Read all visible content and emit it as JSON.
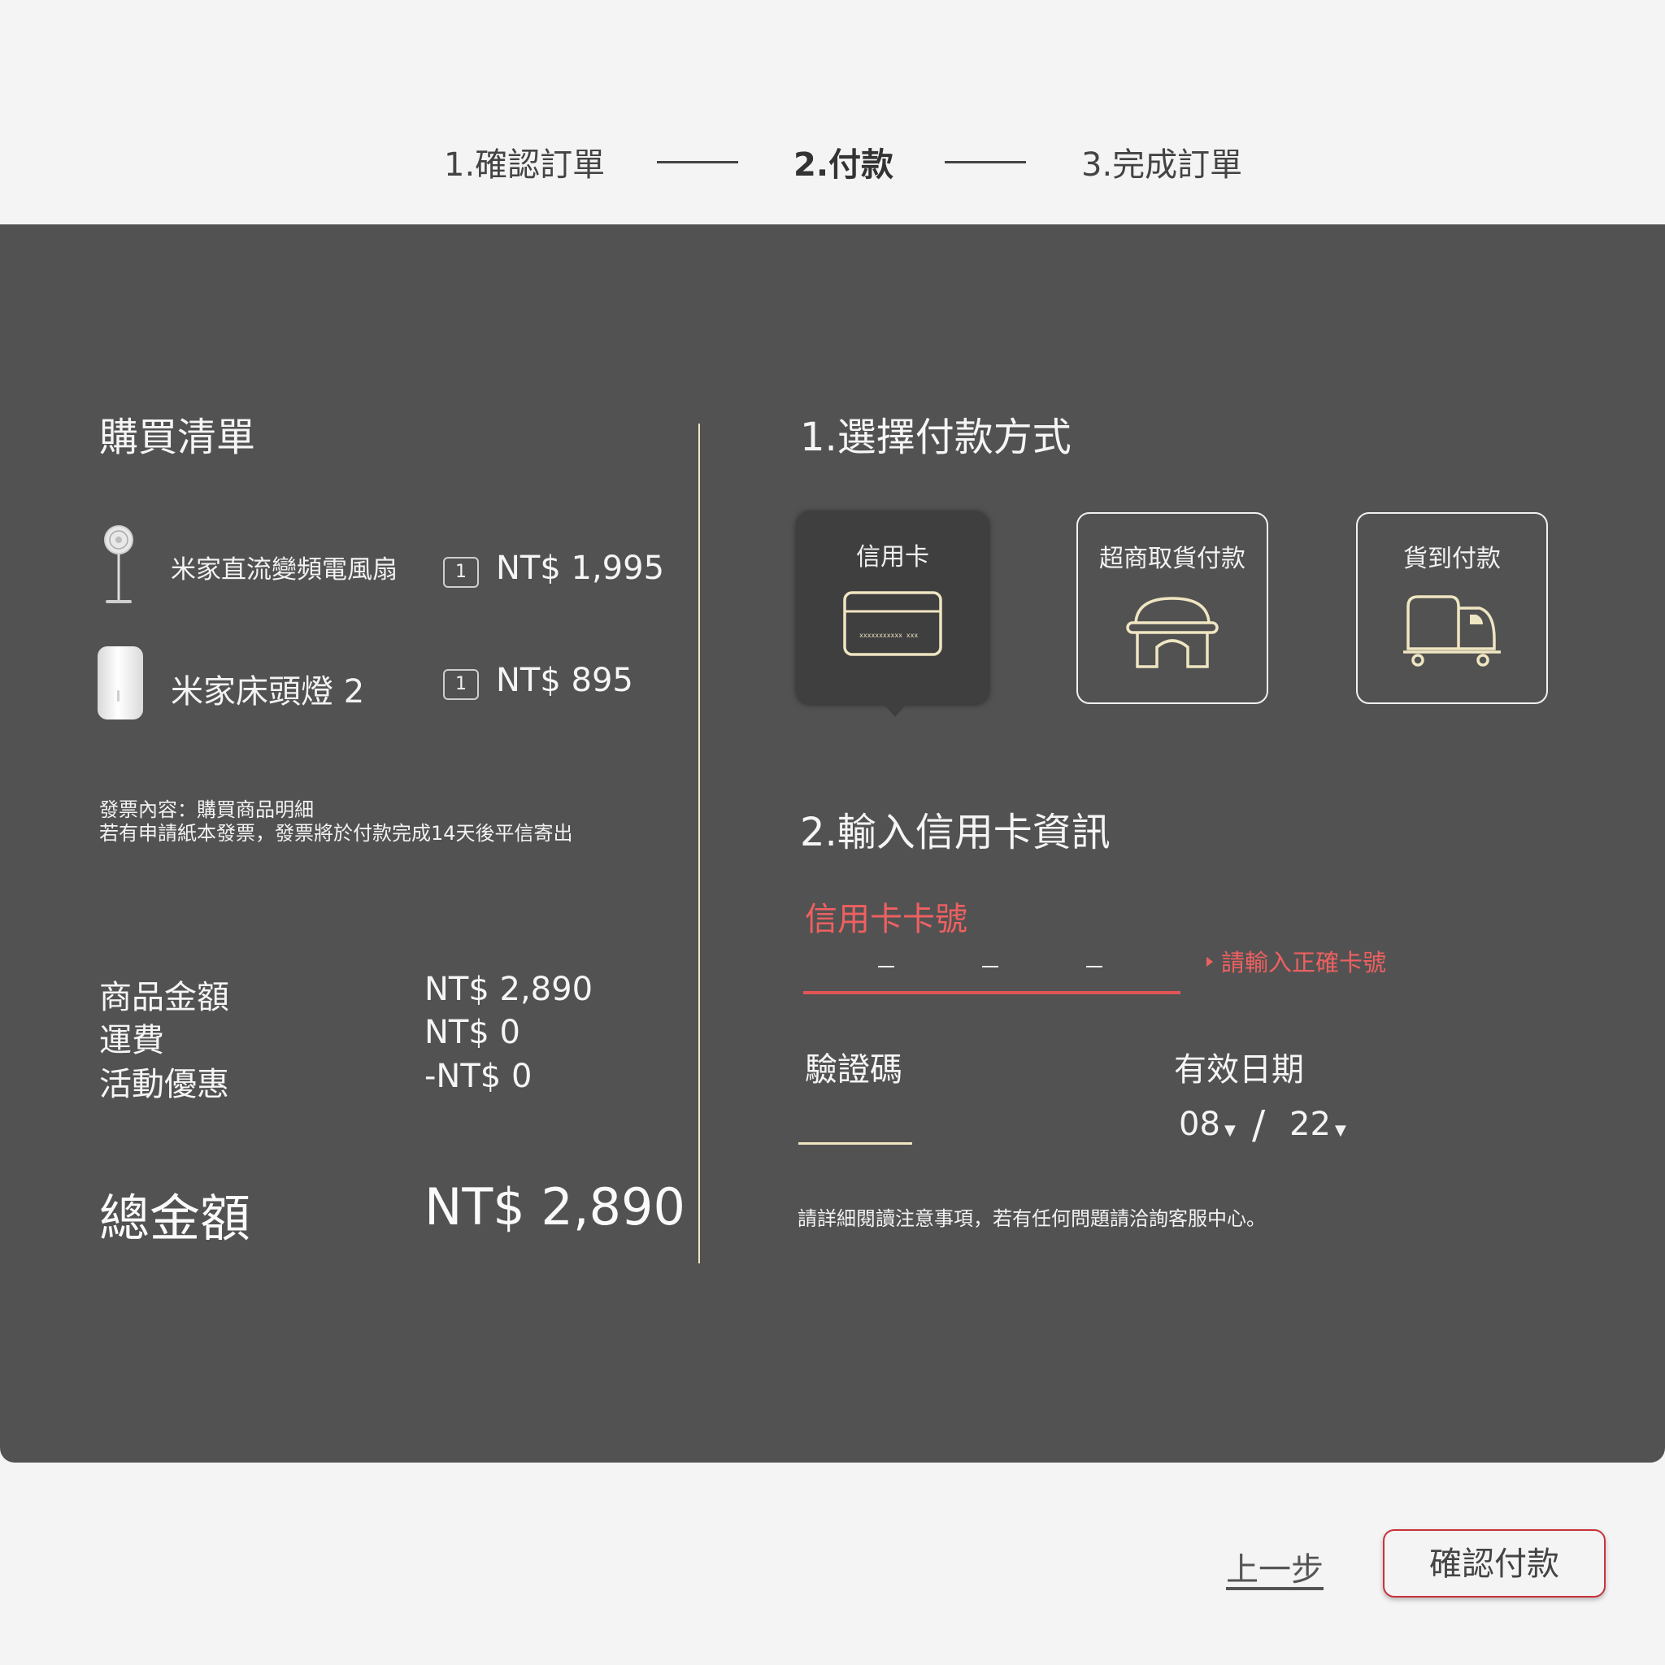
{
  "steps": {
    "step1": "1.確認訂單",
    "step2": "2.付款",
    "step3": "3.完成訂單"
  },
  "order": {
    "title": "購買清單",
    "items": [
      {
        "name": "米家直流變頻電風扇",
        "qty": "1",
        "price": "NT$ 1,995",
        "icon": "fan-icon"
      },
      {
        "name": "米家床頭燈 2",
        "qty": "1",
        "price": "NT$ 895",
        "icon": "lamp-icon"
      }
    ],
    "invoice_line1": "發票內容：購買商品明細",
    "invoice_line2": "若有申請紙本發票，發票將於付款完成14天後平信寄出",
    "summary": {
      "subtotal_label": "商品金額",
      "subtotal_value": "NT$ 2,890",
      "shipping_label": "運費",
      "shipping_value": "NT$ 0",
      "discount_label": "活動優惠",
      "discount_value": "-NT$ 0"
    },
    "total_label": "總金額",
    "total_value": "NT$ 2,890"
  },
  "payment": {
    "method_title": "1.選擇付款方式",
    "methods": [
      {
        "label": "信用卡",
        "icon": "credit-card-icon",
        "selected": true
      },
      {
        "label": "超商取貨付款",
        "icon": "store-icon",
        "selected": false
      },
      {
        "label": "貨到付款",
        "icon": "delivery-truck-icon",
        "selected": false
      }
    ],
    "card_info_title": "2.輸入信用卡資訊",
    "card_number_label": "信用卡卡號",
    "card_number_error": "請輸入正確卡號",
    "cvv_label": "驗證碼",
    "expiry_label": "有效日期",
    "expiry_month": "08",
    "expiry_year": "22",
    "expiry_separator": "/",
    "notice": "請詳細閱讀注意事項，若有任何問題請洽詢客服中心。",
    "card_graphic_text": "xxxxxxxxxxx xxx"
  },
  "actions": {
    "back_label": "上一步",
    "confirm_label": "確認付款"
  },
  "colors": {
    "panel": "#525252",
    "page_bg": "#f4f4f4",
    "error": "#ef6060",
    "accent_line": "#efe6c2",
    "confirm_border": "#c9323a"
  }
}
